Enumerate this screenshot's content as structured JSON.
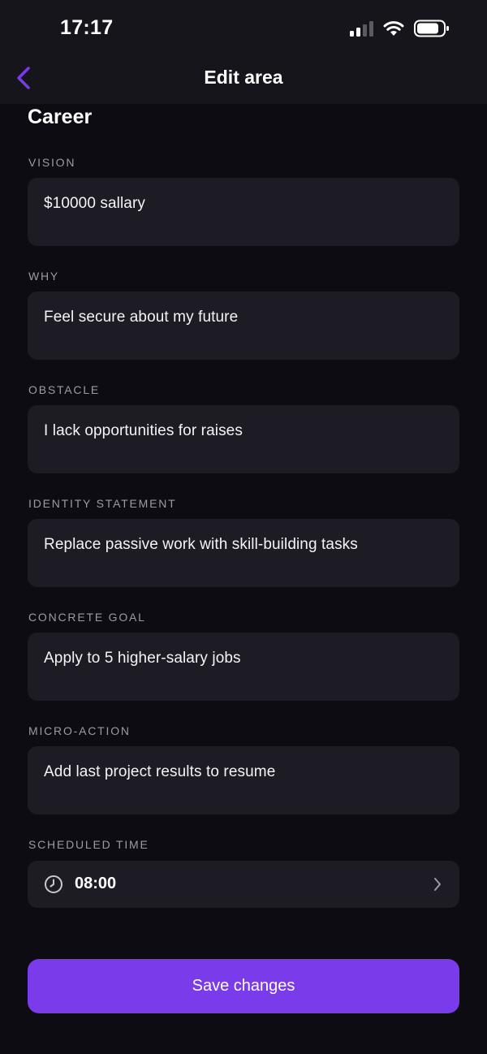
{
  "status_bar": {
    "time": "17:17"
  },
  "nav": {
    "title": "Edit area"
  },
  "area": {
    "title": "Career"
  },
  "fields": [
    {
      "label": "VISION",
      "value": "$10000 sallary"
    },
    {
      "label": "WHY",
      "value": "Feel secure about my future"
    },
    {
      "label": "OBSTACLE",
      "value": "I lack opportunities for raises"
    },
    {
      "label": "IDENTITY STATEMENT",
      "value": "Replace passive work with skill-building tasks"
    },
    {
      "label": "CONCRETE GOAL",
      "value": "Apply to 5 higher-salary jobs"
    },
    {
      "label": "MICRO-ACTION",
      "value": "Add last project results to resume"
    }
  ],
  "schedule": {
    "label": "SCHEDULED TIME",
    "time": "08:00"
  },
  "actions": {
    "save_label": "Save changes"
  },
  "colors": {
    "accent": "#7a3bea",
    "background": "#0d0c12",
    "field": "#1d1c25"
  }
}
